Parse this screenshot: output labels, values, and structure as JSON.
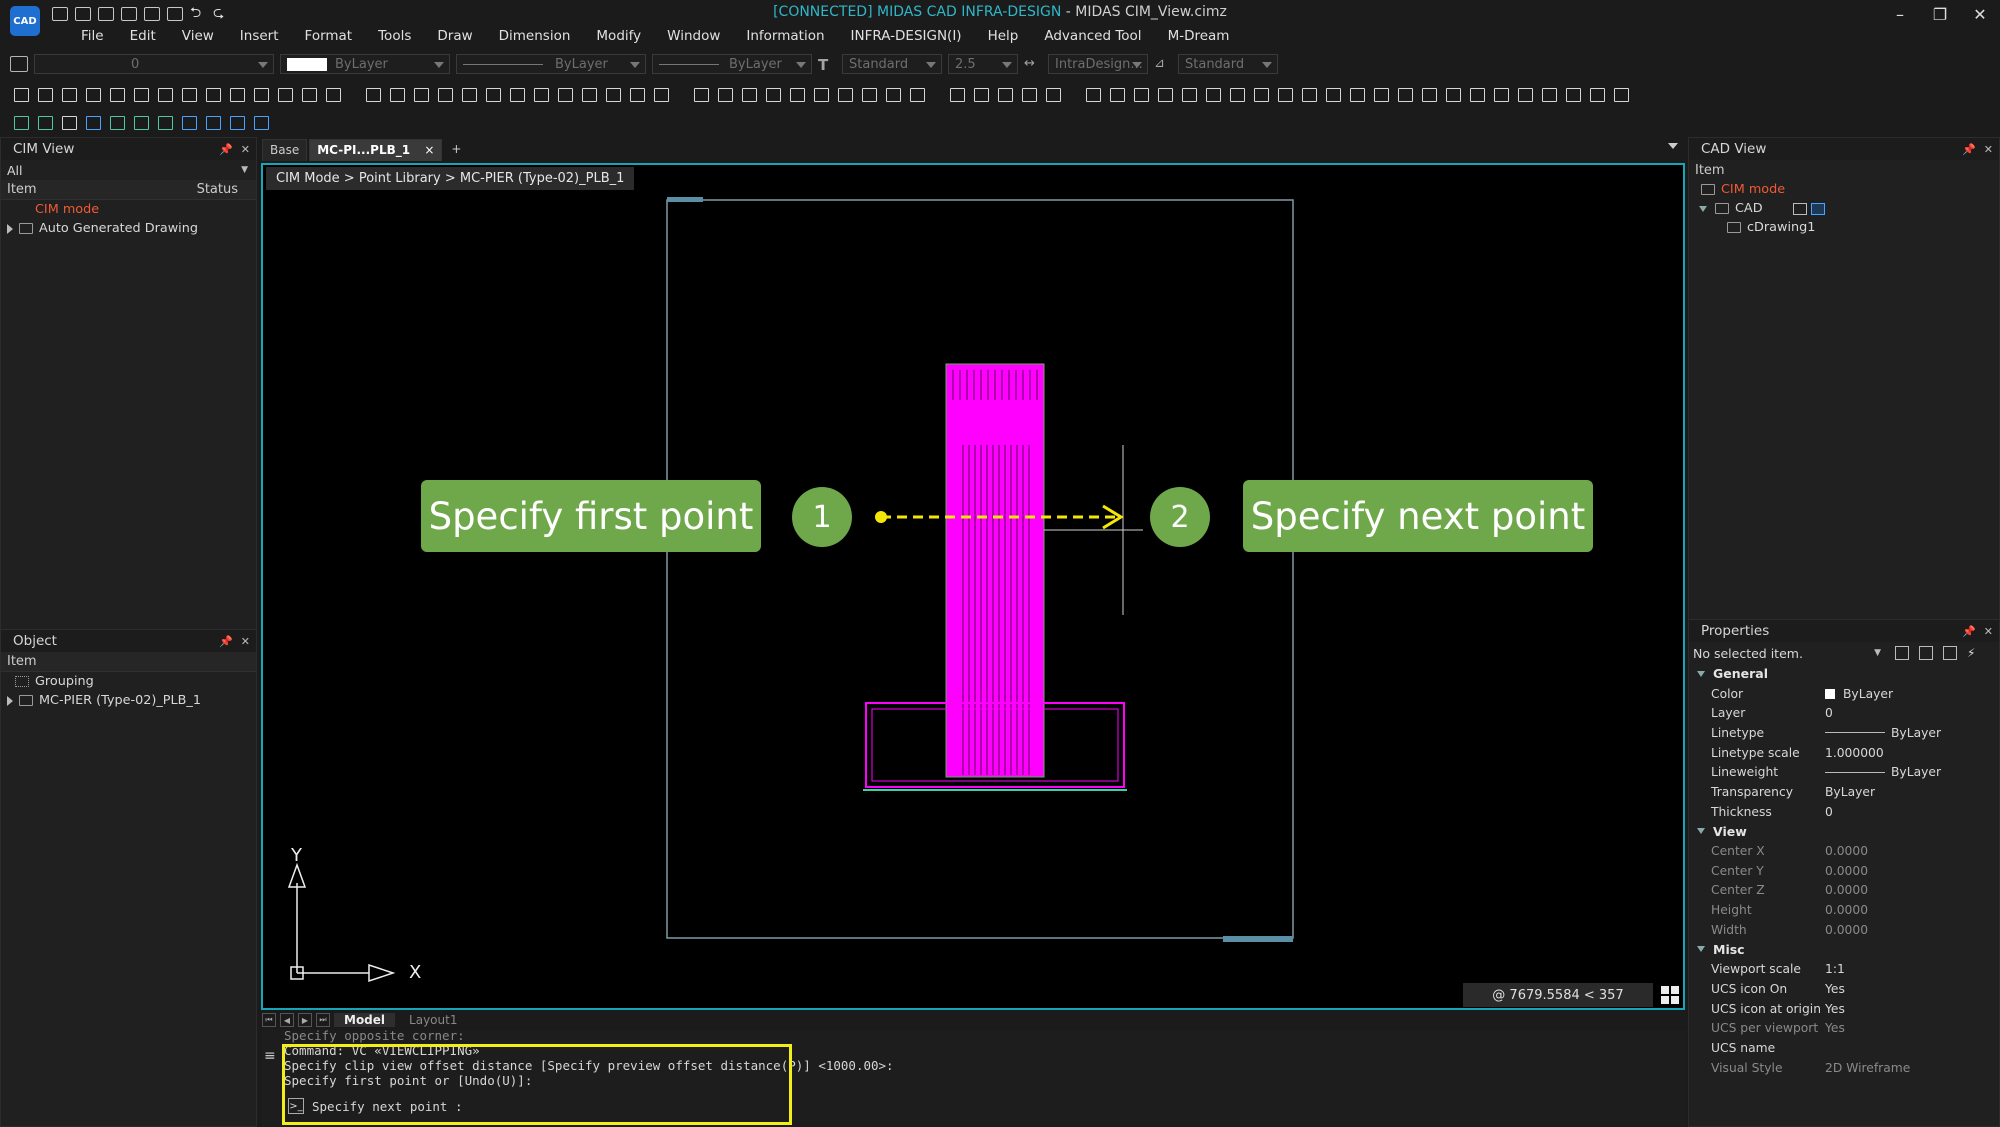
{
  "window": {
    "app_logo": "CAD",
    "title_status": "[CONNECTED] MIDAS CAD INFRA-DESIGN",
    "title_doc": " - MIDAS CIM_View.cimz",
    "minimize": "–",
    "restore": "❐",
    "close": "✕"
  },
  "menu": [
    "File",
    "Edit",
    "View",
    "Insert",
    "Format",
    "Tools",
    "Draw",
    "Dimension",
    "Modify",
    "Window",
    "Information",
    "INFRA-DESIGN(I)",
    "Help",
    "Advanced Tool",
    "M-Dream"
  ],
  "toolbar": {
    "layer_value": "0",
    "color_value": "ByLayer",
    "linetype_value": "ByLayer",
    "lineweight_value": "ByLayer",
    "text_style": "Standard",
    "text_height": "2.5",
    "dim_style": "IntraDesign...",
    "table_style": "Standard"
  },
  "cim_view": {
    "title": "CIM View",
    "filter": "All",
    "col_item": "Item",
    "col_status": "Status",
    "rows": [
      "CIM mode",
      "Auto Generated Drawing"
    ]
  },
  "object_panel": {
    "title": "Object",
    "col_item": "Item",
    "rows": [
      "Grouping",
      "MC-PIER (Type-02)_PLB_1"
    ]
  },
  "doc_tabs": [
    "Base",
    "MC-PI...PLB_1"
  ],
  "tab_close": "×",
  "tab_add": "+",
  "viewport": {
    "breadcrumb": "CIM Mode > Point Library > MC-PIER (Type-02)_PLB_1",
    "axis_y": "Y",
    "axis_x": "X",
    "coord_readout": "@ 7679.5584 < 357"
  },
  "annotations": {
    "first_label": "Specify first point",
    "first_num": "1",
    "next_num": "2",
    "next_label": "Specify next point",
    "arrow_color": "#f5e60a",
    "callout_color": "#6fa84a"
  },
  "layout_tabs": [
    "Model",
    "Layout1"
  ],
  "command": {
    "lines": [
      "Specify opposite corner:",
      "Command:  VC «VIEWCLIPPING»",
      "Specify clip view offset distance [Specify preview offset distance(P)] <1000.00>:",
      "Specify first point or [Undo(U)]:"
    ],
    "prompt": "Specify next point :"
  },
  "cad_view": {
    "title": "CAD View",
    "col_item": "Item",
    "rows": [
      "CIM mode",
      "CAD",
      "cDrawing1"
    ]
  },
  "properties": {
    "title": "Properties",
    "selection": "No selected item.",
    "sections": [
      {
        "name": "General",
        "rows": [
          {
            "k": "Color",
            "v": "ByLayer",
            "swatch": true
          },
          {
            "k": "Layer",
            "v": "0"
          },
          {
            "k": "Linetype",
            "v": "ByLayer",
            "line": true
          },
          {
            "k": "Linetype scale",
            "v": "1.000000"
          },
          {
            "k": "Lineweight",
            "v": "ByLayer",
            "line": true
          },
          {
            "k": "Transparency",
            "v": "ByLayer"
          },
          {
            "k": "Thickness",
            "v": "0"
          }
        ]
      },
      {
        "name": "View",
        "rows": [
          {
            "k": "Center X",
            "v": "0.0000",
            "dim": true
          },
          {
            "k": "Center Y",
            "v": "0.0000",
            "dim": true
          },
          {
            "k": "Center Z",
            "v": "0.0000",
            "dim": true
          },
          {
            "k": "Height",
            "v": "0.0000",
            "dim": true
          },
          {
            "k": "Width",
            "v": "0.0000",
            "dim": true
          }
        ]
      },
      {
        "name": "Misc",
        "rows": [
          {
            "k": "Viewport scale",
            "v": "1:1"
          },
          {
            "k": "UCS icon On",
            "v": "Yes"
          },
          {
            "k": "UCS icon at origin",
            "v": "Yes"
          },
          {
            "k": "UCS per viewport",
            "v": "Yes",
            "dim": true
          },
          {
            "k": "UCS name",
            "v": ""
          },
          {
            "k": "Visual Style",
            "v": "2D Wireframe",
            "dim": true
          }
        ]
      }
    ]
  }
}
